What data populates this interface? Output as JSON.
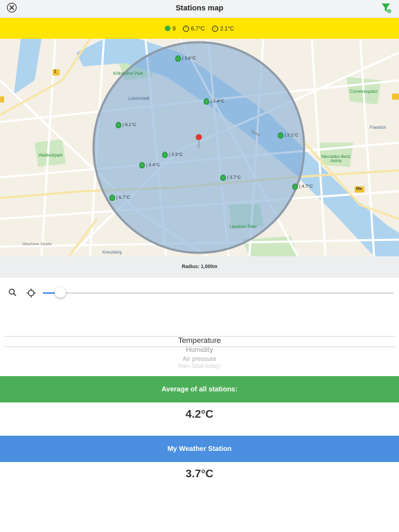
{
  "nav": {
    "title": "Stations map",
    "close_icon": "close-circle-icon",
    "filter_icon": "filter-settings-icon"
  },
  "summary": {
    "station_count": "9",
    "max_temp": "6.7°C",
    "min_temp": "2.1°C"
  },
  "map": {
    "streets": [
      "Kreuzberg",
      "Luisenstadt",
      "Friedrich",
      "Gitschiner Straße",
      "Spree"
    ],
    "parks": [
      "Köllnischer Park",
      "Waldeckpark",
      "Comeniusplatz",
      "Mercedes-Benz Arena",
      "Lausitzer Platz"
    ],
    "route_badges": [
      "1",
      "96a"
    ],
    "stations": [
      {
        "label": "| 3.6°C"
      },
      {
        "label": "| 2.4°C"
      },
      {
        "label": "| 6.1°C"
      },
      {
        "label": "| 2.1°C"
      },
      {
        "label": "| 3.9°C"
      },
      {
        "label": "| 4.4°C"
      },
      {
        "label": "| 3.7°C"
      },
      {
        "label": "| 4.7°C"
      },
      {
        "label": "| 6.7°C"
      }
    ],
    "radius_fill_color": "#7aa7d6",
    "radius_border_color": "#8e9aa6"
  },
  "radius": {
    "label": "Radius: 1,000m",
    "slider_value_fraction": 0.05
  },
  "picker": {
    "options": [
      "Temperature",
      "Humidity",
      "Air pressure",
      "Rain (total today)"
    ],
    "selected": "Temperature"
  },
  "average": {
    "header": "Average of all stations:",
    "value": "4.2°C",
    "color": "#4cae58"
  },
  "my_station": {
    "header": "My Weather Station",
    "value": "3.7°C",
    "color": "#4a8fe0"
  }
}
